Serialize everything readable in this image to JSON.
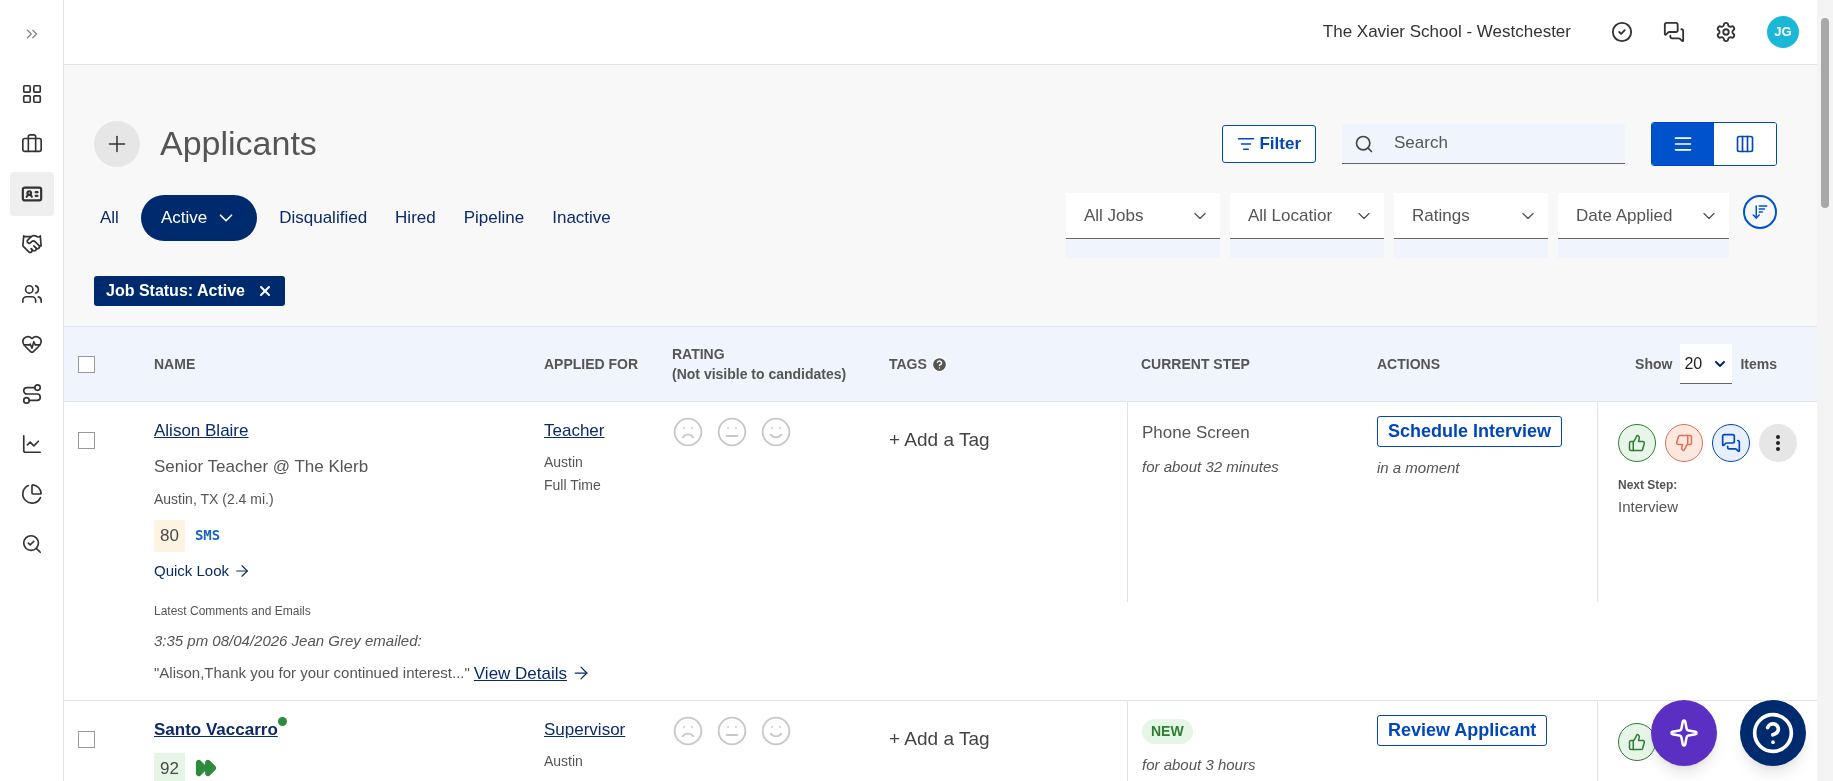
{
  "sidebar": {
    "items": [
      {
        "kind": "expand",
        "selected": false
      },
      {
        "kind": "dashboard",
        "selected": false
      },
      {
        "kind": "jobs",
        "selected": false
      },
      {
        "kind": "applicants",
        "selected": true
      },
      {
        "kind": "hiring",
        "selected": false
      },
      {
        "kind": "people",
        "selected": false
      },
      {
        "kind": "health",
        "selected": false
      },
      {
        "kind": "journey",
        "selected": false
      },
      {
        "kind": "trends",
        "selected": false
      },
      {
        "kind": "reports",
        "selected": false
      },
      {
        "kind": "insights",
        "selected": false
      }
    ]
  },
  "header": {
    "organization": "The Xavier School - Westchester",
    "avatar": "JG"
  },
  "page": {
    "title": "Applicants",
    "filter_button": "Filter",
    "search": {
      "placeholder": "Search"
    },
    "view_toggle": [
      {
        "kind": "list",
        "selected": true
      },
      {
        "kind": "board",
        "selected": false
      }
    ]
  },
  "tabs": [
    {
      "label": "All",
      "selected": false,
      "has_menu": false
    },
    {
      "label": "Active",
      "selected": true,
      "has_menu": true
    },
    {
      "label": "Disqualified",
      "selected": false,
      "has_menu": false
    },
    {
      "label": "Hired",
      "selected": false,
      "has_menu": false
    },
    {
      "label": "Pipeline",
      "selected": false,
      "has_menu": false
    },
    {
      "label": "Inactive",
      "selected": false,
      "has_menu": false
    }
  ],
  "dropdowns": [
    "All Jobs",
    "All Locatior",
    "Ratings",
    "Date Applied"
  ],
  "chips": [
    {
      "label": "Job Status: Active"
    }
  ],
  "table": {
    "columns": [
      {
        "label": "NAME"
      },
      {
        "label": "APPLIED FOR"
      },
      {
        "label": "RATING",
        "note": "(Not visible to candidates)"
      },
      {
        "label": "TAGS",
        "help": true
      },
      {
        "label": "CURRENT STEP"
      },
      {
        "label": "ACTIONS"
      }
    ],
    "select_all": {
      "checked": false
    },
    "page_size": {
      "show": "Show",
      "value": "20",
      "items": "Items"
    },
    "rows": [
      {
        "checked": false,
        "name": "Alison Blaire",
        "bold": false,
        "online": false,
        "headline": "Senior Teacher @ The Klerb",
        "location": "Austin, TX (2.4 mi.)",
        "score": "80",
        "color": "#fdf3e1",
        "channel": "SMS",
        "fast_track": false,
        "quick_look": "Quick Look",
        "job": "Teacher",
        "job_location": "Austin",
        "job_type": "Full Time",
        "add_tag": "+ Add a Tag",
        "step": {
          "kind": "text",
          "label": "Phone Screen"
        },
        "step_time": "for about 32 minutes",
        "action": "Schedule Interview",
        "action_time": "in a moment",
        "next_step_label": "Next Step:",
        "next_step": "Interview",
        "comments": {
          "heading": "Latest Comments and Emails",
          "meta": "3:35 pm 08/04/2026 Jean Grey emailed:",
          "excerpt": "\"Alison,Thank you for your continued interest...\"",
          "link": "View Details"
        }
      },
      {
        "checked": false,
        "name": "Santo Vaccarro",
        "bold": true,
        "online": true,
        "score": "92",
        "color": "#e6f6e6",
        "fast_track": true,
        "job": "Supervisor",
        "job_location": "Austin",
        "add_tag": "+ Add a Tag",
        "step": {
          "kind": "badge",
          "label": "NEW"
        },
        "step_time": "for about 3 hours",
        "action": "Review Applicant"
      }
    ]
  }
}
